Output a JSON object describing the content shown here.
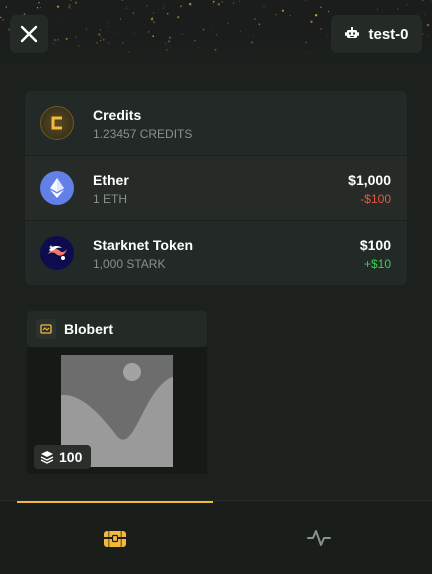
{
  "header": {
    "close_icon": "close-icon",
    "account_icon": "robot-icon",
    "account_name": "test-0"
  },
  "tokens": [
    {
      "name": "Credits",
      "amount": "1.23457 CREDITS",
      "value": "",
      "change": "",
      "icon": "credits-icon"
    },
    {
      "name": "Ether",
      "amount": "1 ETH",
      "value": "$1,000",
      "change": "-$100",
      "icon": "ether-icon"
    },
    {
      "name": "Starknet Token",
      "amount": "1,000 STARK",
      "value": "$100",
      "change": "+$10",
      "icon": "starknet-icon"
    }
  ],
  "collection": {
    "title": "Blobert",
    "icon": "collection-icon",
    "nft_count": "100",
    "nft_image": "placeholder-image-icon"
  },
  "tabs": [
    {
      "name": "inventory",
      "icon": "chest-icon",
      "active": true
    },
    {
      "name": "activity",
      "icon": "pulse-icon",
      "active": false
    }
  ],
  "colors": {
    "accent": "#f2b93b",
    "negative": "#e05a4a",
    "positive": "#3fce5a",
    "background": "#1c211e"
  }
}
